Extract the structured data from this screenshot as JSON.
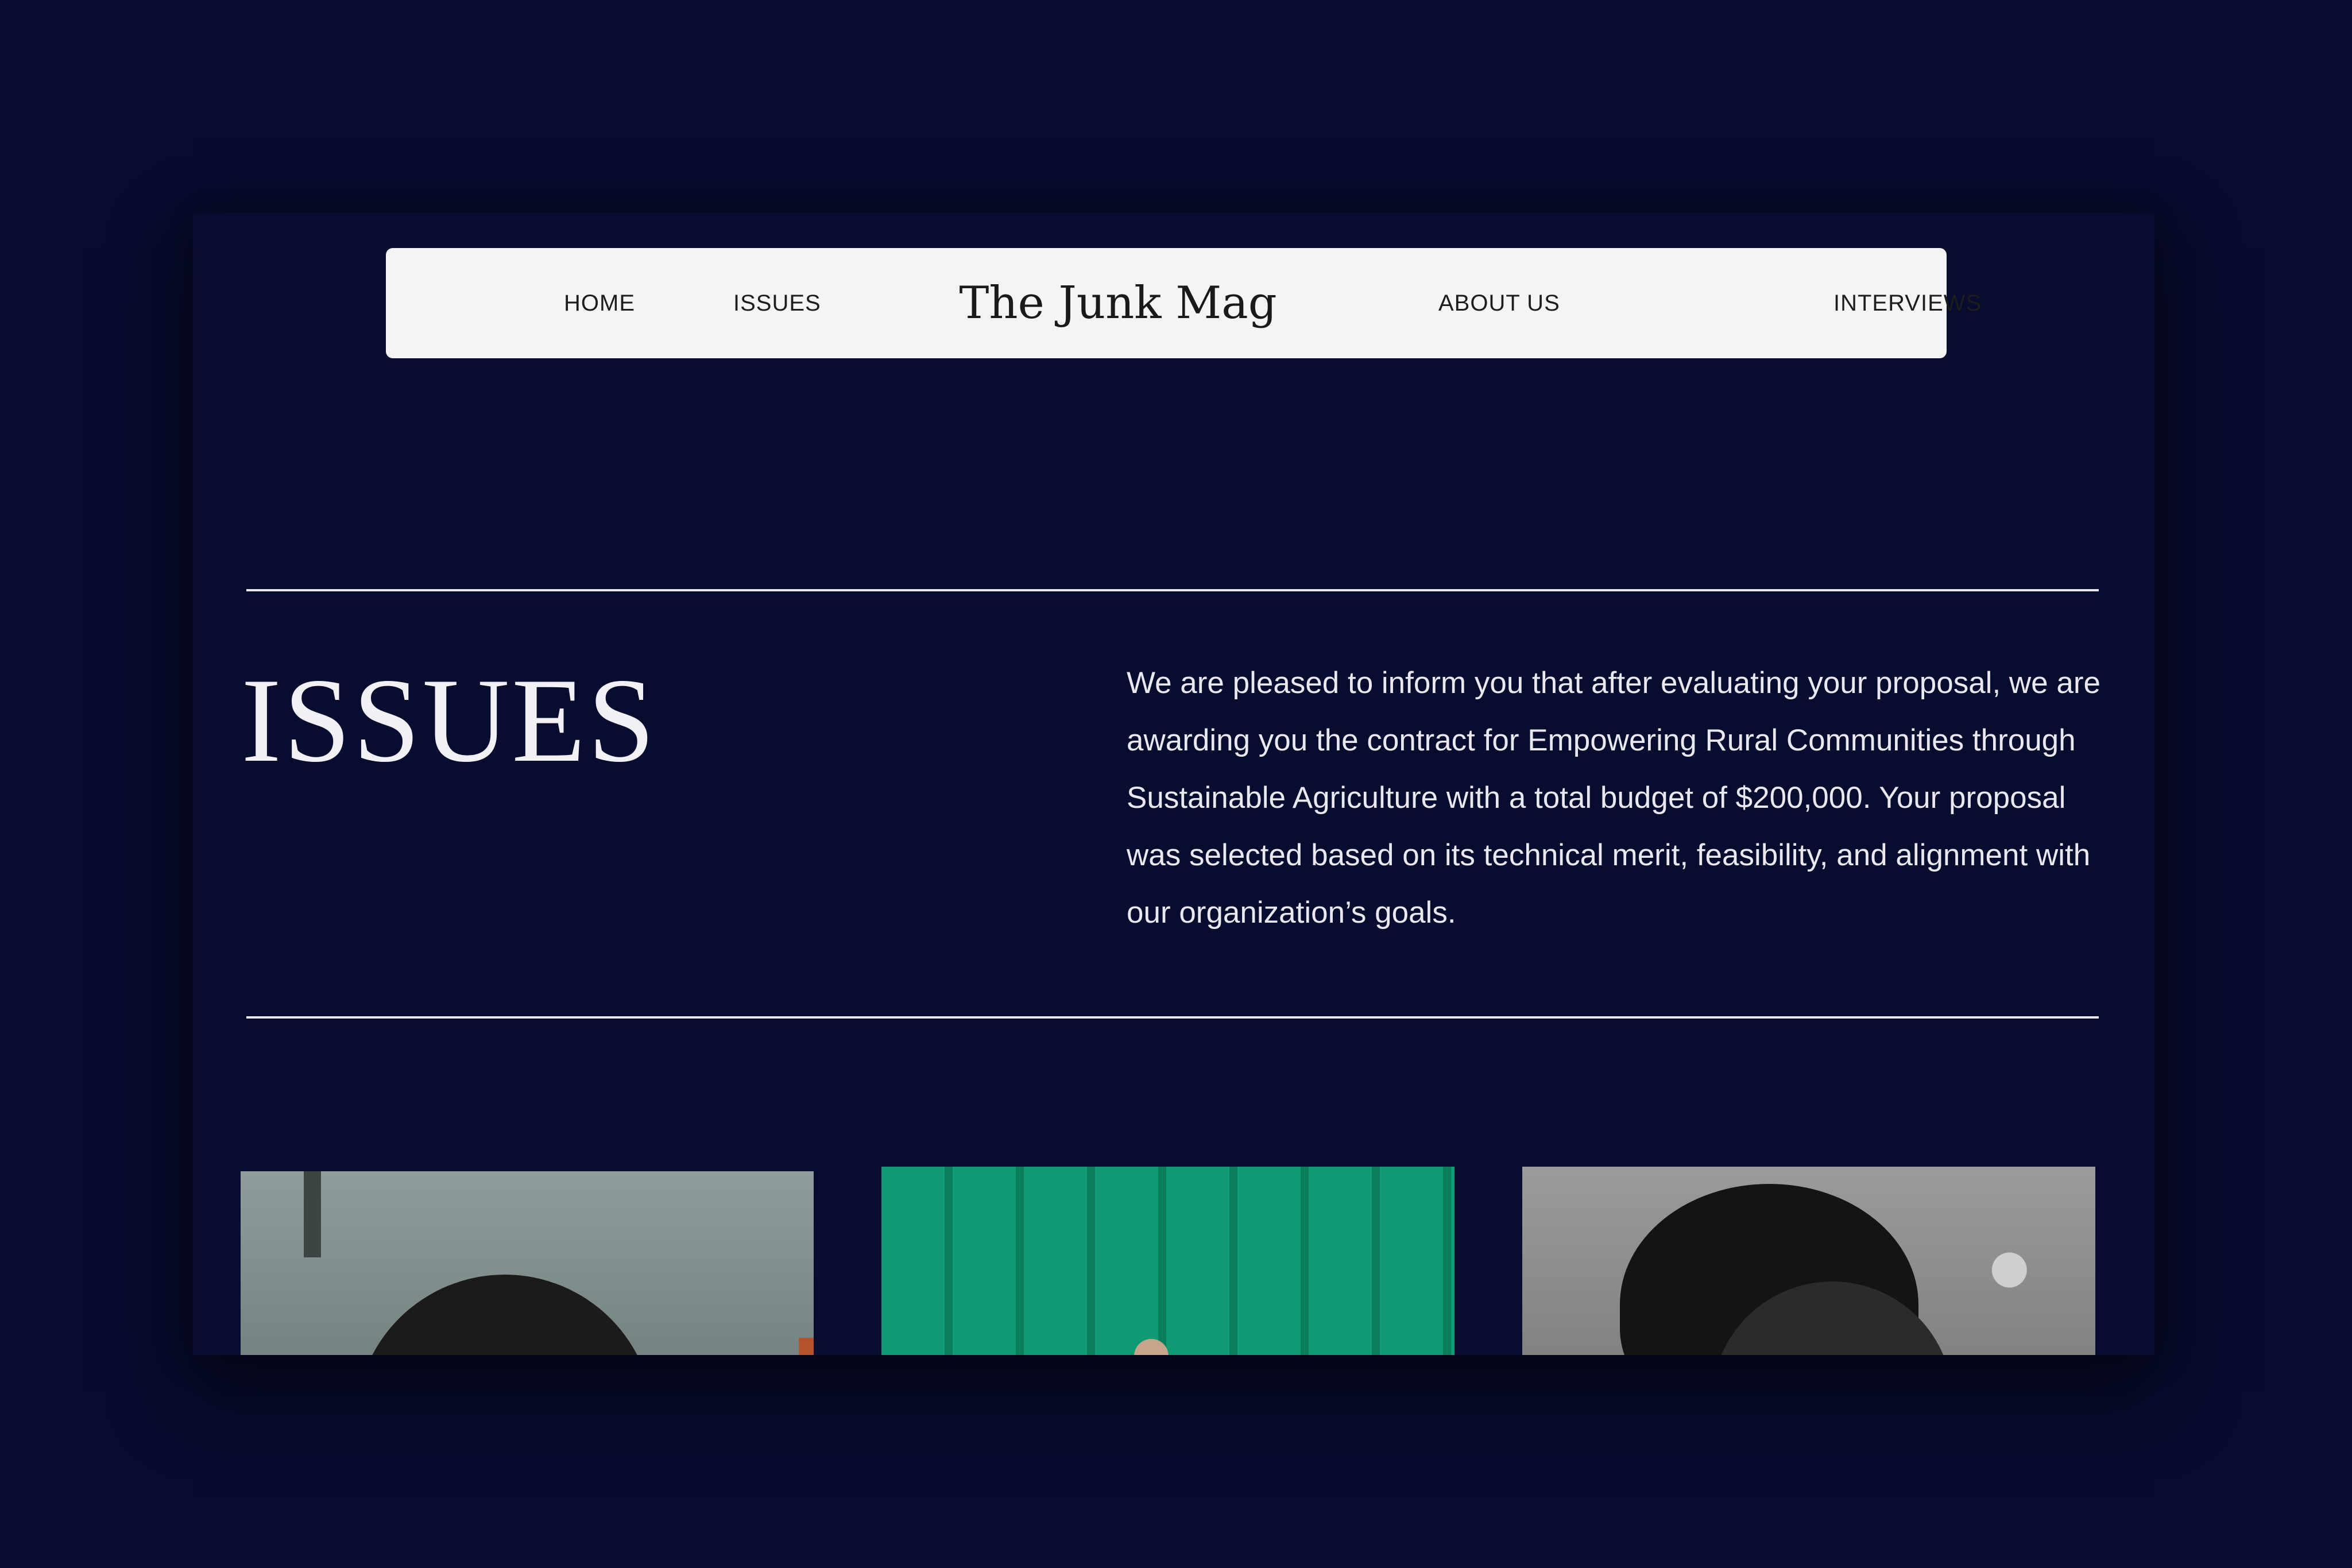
{
  "colors": {
    "background": "#080c2e",
    "navbar_background": "#f4f4f4",
    "text_light": "#f1f1f5",
    "text_dark": "#1d1d1d"
  },
  "nav": {
    "home": "HOME",
    "issues": "ISSUES",
    "brand": "The Junk Mag",
    "about": "ABOUT US",
    "interviews": "INTERVIEWS"
  },
  "section": {
    "title": "ISSUES",
    "description": "We are pleased to inform you that after evaluating your proposal, we are awarding you the contract for Empowering Rural Communities through Sustainable Agriculture with a total budget of $200,000. Your proposal was selected based on its technical merit, feasibility, and alignment with our organization’s goals."
  },
  "cards": [
    {
      "image": "portrait-photo"
    },
    {
      "image": "green-curtain-photo"
    },
    {
      "image": "monochrome-portrait-photo"
    }
  ]
}
